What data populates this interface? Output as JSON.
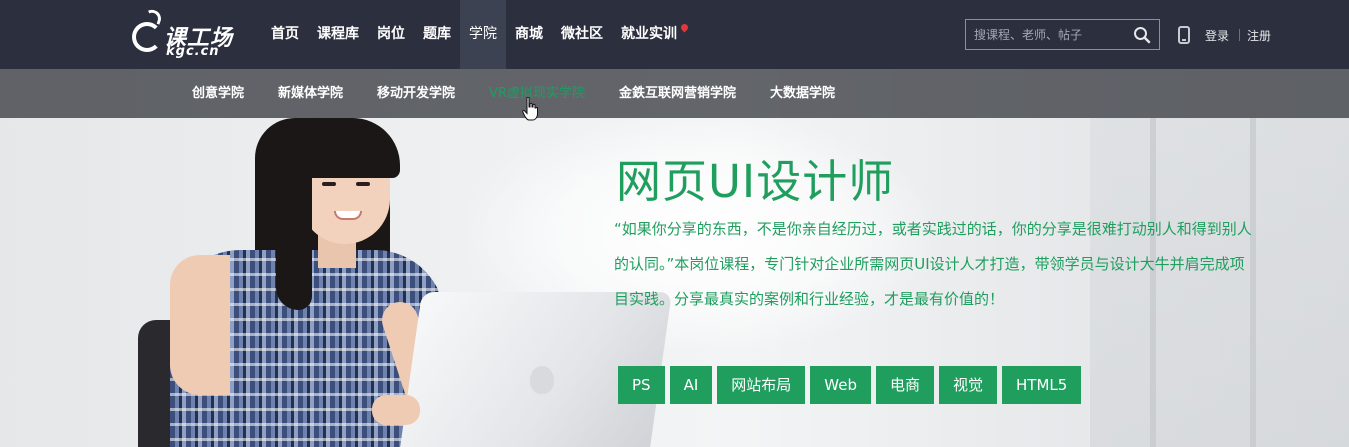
{
  "logo": {
    "cn": "课工场",
    "en": "kgc.cn"
  },
  "nav": {
    "items": [
      {
        "label": "首页"
      },
      {
        "label": "课程库"
      },
      {
        "label": "岗位"
      },
      {
        "label": "题库"
      },
      {
        "label": "学院"
      },
      {
        "label": "商城"
      },
      {
        "label": "微社区"
      },
      {
        "label": "就业实训"
      }
    ],
    "active": "学院"
  },
  "search": {
    "placeholder": "搜课程、老师、帖子"
  },
  "account": {
    "login": "登录",
    "register": "注册"
  },
  "subnav": {
    "items": [
      {
        "label": "创意学院"
      },
      {
        "label": "新媒体学院"
      },
      {
        "label": "移动开发学院"
      },
      {
        "label": "VR虚拟现实学院"
      },
      {
        "label": "金鉄互联网营销学院"
      },
      {
        "label": "大数据学院"
      }
    ],
    "hovered": "VR虚拟现实学院"
  },
  "hero": {
    "title": "网页UI设计师",
    "description": "“如果你分享的东西，不是你亲自经历过，或者实践过的话，你的分享是很难打动别人和得到别人的认同。”本岗位课程，专门针对企业所需网页UI设计人才打造，带领学员与设计大牛并肩完成项目实践。分享最真实的案例和行业经验，才是最有价值的！",
    "tags": [
      "PS",
      "AI",
      "网站布局",
      "Web",
      "电商",
      "视觉",
      "HTML5"
    ]
  },
  "colors": {
    "topbar": "#2b2f3e",
    "accent": "#1f9e5e",
    "subnav": "#3a3c42"
  },
  "icons": [
    "search-icon",
    "phone-icon",
    "location-pin-icon",
    "hand-cursor-icon"
  ]
}
